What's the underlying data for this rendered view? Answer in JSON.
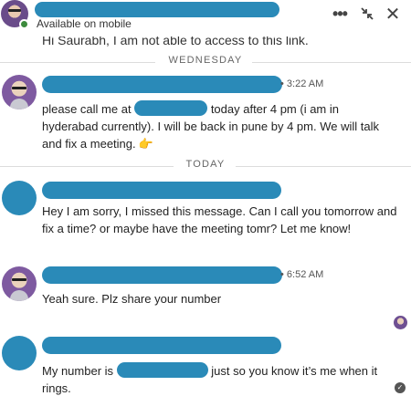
{
  "header": {
    "status": "Available on mobile",
    "more_icon": "more-dots-icon",
    "minimize_icon": "collapse-arrows-icon",
    "close_icon": "close-icon",
    "more_glyph": "•••",
    "close_glyph": "✕",
    "shrink_glyph": "⤡"
  },
  "clipped_message": "Hi Saurabh, I am not able to access to this link.",
  "dividers": {
    "wednesday": "WEDNESDAY",
    "today": "TODAY"
  },
  "messages": [
    {
      "time": "3:22 AM",
      "text_before": "please call me at",
      "text_after": "today after 4 pm (i am in hyderabad currently). I will be back in pune by 4 pm. We will talk and fix a meeting.",
      "emoji": "👈"
    },
    {
      "time": "",
      "text": "Hey I am sorry, I missed this message. Can I call you tomorrow and fix a time? or maybe have the meeting tomr? Let me know!"
    },
    {
      "time": "6:52 AM",
      "text": "Yeah sure. Plz share your number"
    },
    {
      "time": "",
      "text_before": "My number is",
      "text_after": "just so you know it’s me when it rings."
    }
  ],
  "read_receipt_glyph": "✓",
  "colors": {
    "redaction": "#2a8ab8",
    "online": "#3d8b3d",
    "divider_line": "#dcdcdc"
  }
}
